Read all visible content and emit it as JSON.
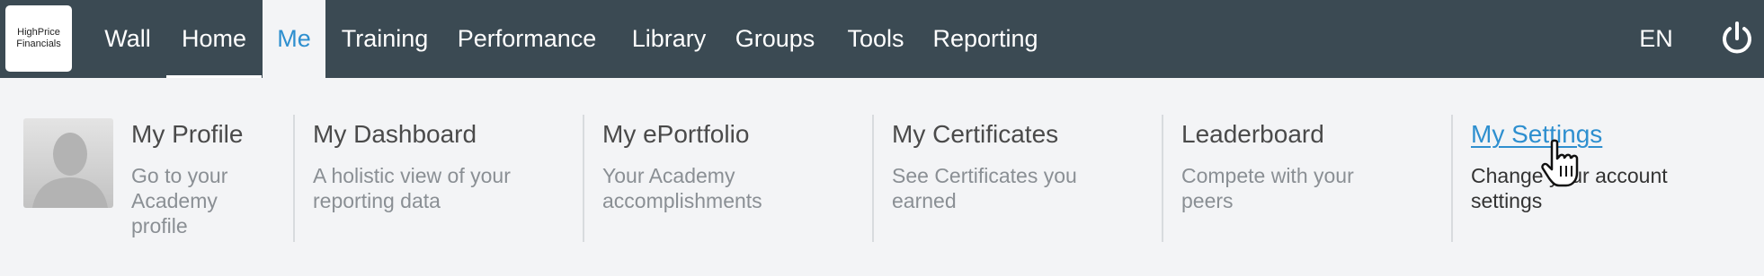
{
  "brand": {
    "line1": "HighPrice",
    "line2": "Financials"
  },
  "nav": {
    "wall": "Wall",
    "home": "Home",
    "me": "Me",
    "training": "Training",
    "performance": "Performance",
    "library": "Library",
    "groups": "Groups",
    "tools": "Tools",
    "reporting": "Reporting",
    "language": "EN",
    "power_icon": "power-icon"
  },
  "menu": {
    "profile": {
      "title": "My Profile",
      "desc": "Go to your Academy profile"
    },
    "dashboard": {
      "title": "My Dashboard",
      "desc": "A holistic view of your reporting data"
    },
    "eportfolio": {
      "title": "My ePortfolio",
      "desc": "Your Academy accomplishments"
    },
    "certificates": {
      "title": "My Certificates",
      "desc": "See Certificates you earned"
    },
    "leaderboard": {
      "title": "Leaderboard",
      "desc": "Compete with your peers"
    },
    "settings": {
      "title": "My Settings",
      "desc": "Change your account settings"
    }
  },
  "colors": {
    "topbar": "#3b4a53",
    "accent": "#2e8fcf",
    "menu_bg": "#f3f4f6"
  }
}
